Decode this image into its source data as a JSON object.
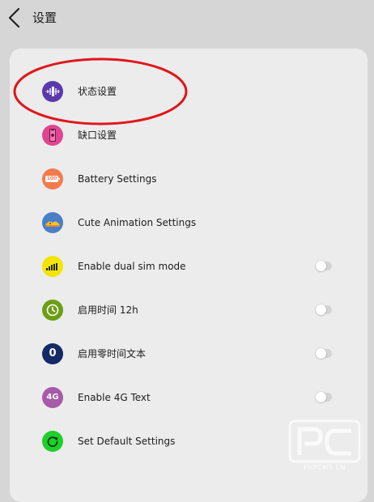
{
  "header": {
    "title": "设置",
    "back_icon": "chevron-left-icon"
  },
  "colors": {
    "background": "#d6d6d6",
    "card": "#ececec",
    "annotation_red": "#e0161b"
  },
  "settings": [
    {
      "label": "状态设置",
      "icon": "status-settings-icon",
      "icon_color": "#5a3aa8",
      "has_toggle": false
    },
    {
      "label": "缺口设置",
      "icon": "notch-settings-icon",
      "icon_color": "#e2458f",
      "has_toggle": false
    },
    {
      "label": "Battery Settings",
      "icon": "battery-icon",
      "icon_color": "#f27b4e",
      "icon_text": "100",
      "has_toggle": false
    },
    {
      "label": "Cute Animation Settings",
      "icon": "animation-icon",
      "icon_color": "#4a7fc8",
      "has_toggle": false
    },
    {
      "label": "Enable dual sim mode",
      "icon": "signal-bars-icon",
      "icon_color": "#f4e500",
      "has_toggle": true,
      "toggle_on": false
    },
    {
      "label": "启用时间 12h",
      "icon": "clock-icon",
      "icon_color": "#6c9e16",
      "has_toggle": true,
      "toggle_on": false
    },
    {
      "label": "启用零时间文本",
      "icon": "zero-icon",
      "icon_color": "#142a66",
      "icon_text": "0",
      "has_toggle": true,
      "toggle_on": false
    },
    {
      "label": "Enable 4G Text",
      "icon": "4g-icon",
      "icon_color": "#a65aa8",
      "icon_text": "4G",
      "has_toggle": true,
      "toggle_on": false
    },
    {
      "label": "Set Default Settings",
      "icon": "reset-icon",
      "icon_color": "#1fcf2a",
      "has_toggle": false
    }
  ],
  "watermark": {
    "text": "PHPCMS.CN"
  }
}
